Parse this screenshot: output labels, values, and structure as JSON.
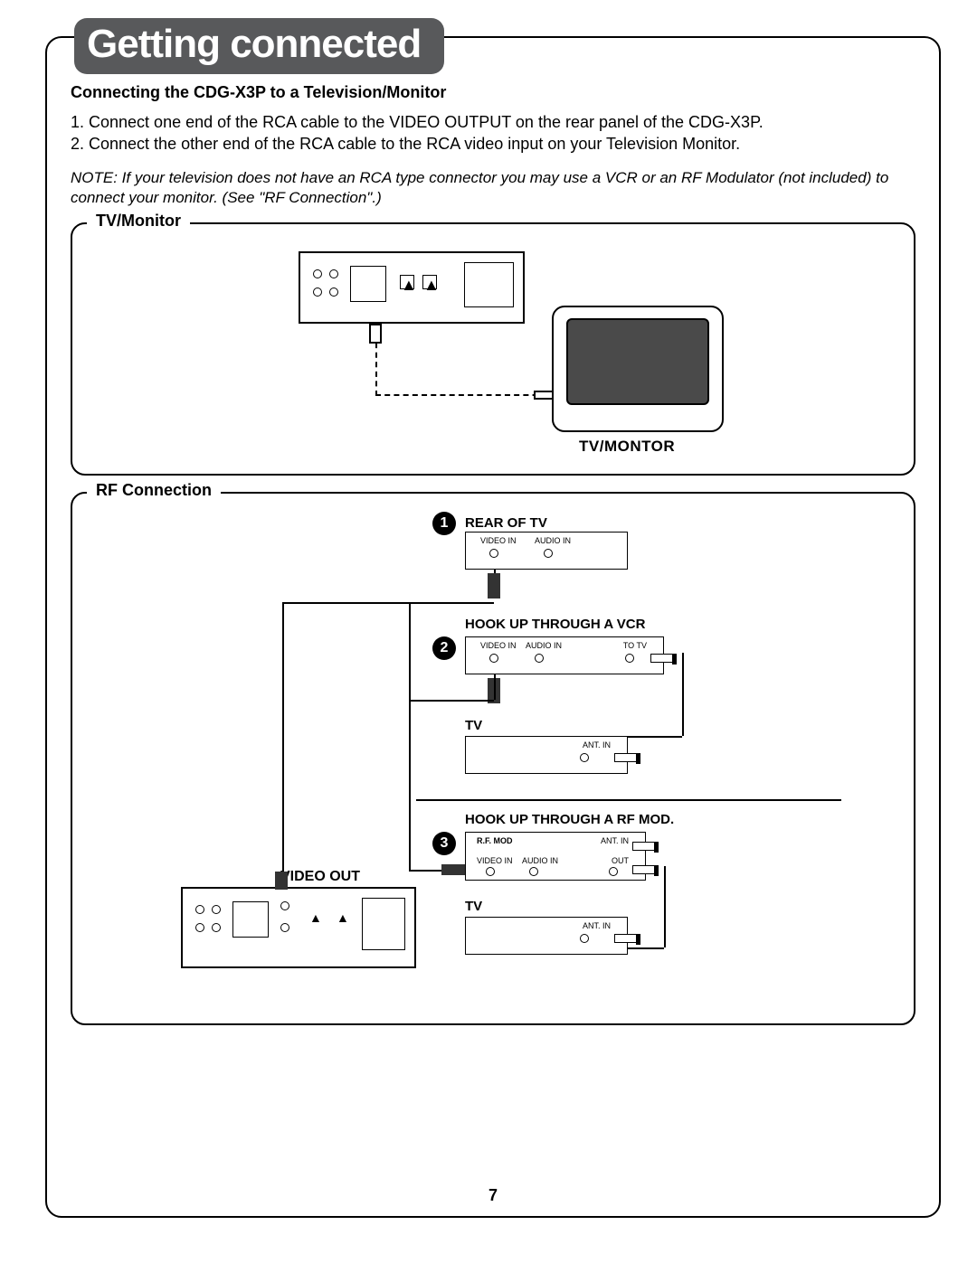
{
  "title": "Getting connected",
  "subhead": "Connecting the CDG-X3P to a Television/Monitor",
  "steps": {
    "s1": "1. Connect one end of the RCA cable to the VIDEO OUTPUT on the rear panel of the CDG-X3P.",
    "s2": "2. Connect the other end of the RCA cable to the RCA video input on your Television Monitor."
  },
  "note": "NOTE: If your television does not have an RCA type connector you may use a VCR or an RF Modulator (not included) to connect your monitor. (See \"RF Connection\".)",
  "panel1_label": "TV/Monitor",
  "panel1_tv_caption": "TV/MONTOR",
  "panel2_label": "RF Connection",
  "rf": {
    "step1_title": "REAR OF TV",
    "step2_title": "HOOK UP THROUGH A VCR",
    "step3_title": "HOOK UP THROUGH A RF MOD.",
    "video_out": "VIDEO OUT",
    "tv": "TV",
    "rfmod": "R.F. MOD",
    "video_in": "VIDEO IN",
    "audio_in": "AUDIO IN",
    "to_tv": "TO TV",
    "ant_in": "ANT. IN",
    "out": "OUT"
  },
  "page_number": "7"
}
